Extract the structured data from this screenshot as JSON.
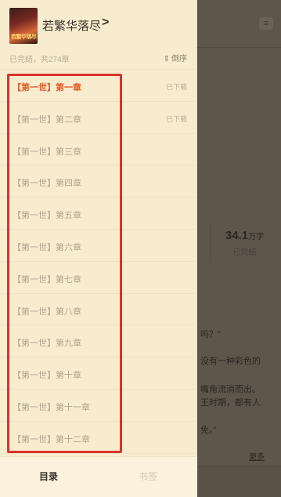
{
  "book": {
    "title": "若繁华落尽",
    "title_arrow": ">",
    "cover_text": "若繁华落尽",
    "meta": "已完结，共274章"
  },
  "sort": {
    "icon": "⇕",
    "label": "倒序"
  },
  "chapters": [
    {
      "title": "【第一世】第一章",
      "status": "已下载"
    },
    {
      "title": "【第一世】第二章",
      "status": "已下载"
    },
    {
      "title": "【第一世】第三章",
      "status": ""
    },
    {
      "title": "【第一世】第四章",
      "status": ""
    },
    {
      "title": "【第一世】第五章",
      "status": ""
    },
    {
      "title": "【第一世】第六章",
      "status": ""
    },
    {
      "title": "【第一世】第七章",
      "status": ""
    },
    {
      "title": "【第一世】第八章",
      "status": ""
    },
    {
      "title": "【第一世】第九章",
      "status": ""
    },
    {
      "title": "【第一世】第十章",
      "status": ""
    },
    {
      "title": "【第一世】第十一章",
      "status": ""
    },
    {
      "title": "【第一世】第十二章",
      "status": ""
    }
  ],
  "active_chapter_index": 0,
  "tabs": {
    "catalog": "目录",
    "bookmarks": "书签"
  },
  "background": {
    "menu_icon": "≡",
    "stat_value": "34.1",
    "stat_unit": "万字",
    "stat_label": "已完结",
    "text_lines": [
      "吗？”",
      "没有一种彩色的",
      "嘴角流淌而出。",
      "王时期，都有人",
      "免。”"
    ],
    "more": "更多"
  },
  "colors": {
    "drawer_bg": "#f8eccf",
    "active_chapter": "#e05a27",
    "highlight_frame": "#d9322e",
    "overlay": "#5e564b"
  }
}
